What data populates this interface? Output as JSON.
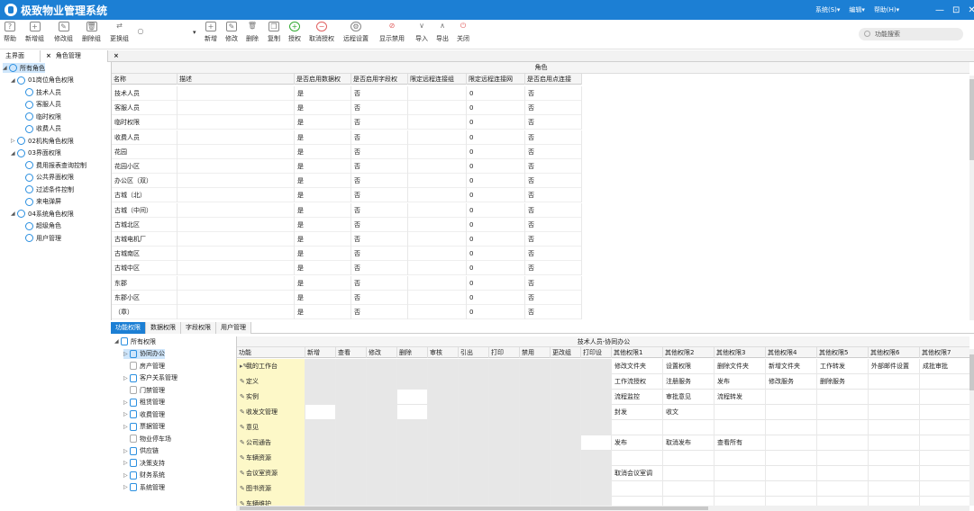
{
  "window": {
    "title": "极致物业管理系统",
    "menus": [
      "系统(S)▾",
      "编辑▾",
      "帮助(H)▾"
    ],
    "controls": [
      "—",
      "⊡",
      "✕"
    ]
  },
  "toolbar": {
    "left": [
      {
        "label": "帮助",
        "icon": "help-icon",
        "glyph": "?"
      },
      {
        "label": "新增组",
        "icon": "add-group-icon",
        "glyph": "+"
      },
      {
        "label": "修改组",
        "icon": "edit-group-icon",
        "glyph": "✎"
      },
      {
        "label": "删除组",
        "icon": "delete-group-icon",
        "glyph": "🗑"
      },
      {
        "label": "更换组",
        "icon": "swap-group-icon",
        "glyph": "⇄"
      },
      {
        "label": "",
        "icon": "search-icon",
        "glyph": "○"
      }
    ],
    "right": [
      {
        "label": "新增",
        "icon": "new-icon",
        "glyph": "+"
      },
      {
        "label": "修改",
        "icon": "edit-icon",
        "glyph": "✎"
      },
      {
        "label": "删除",
        "icon": "delete-icon",
        "glyph": "🗑"
      },
      {
        "label": "复制",
        "icon": "copy-icon",
        "glyph": "❐"
      },
      {
        "label": "授权",
        "icon": "authorize-icon",
        "glyph": "+"
      },
      {
        "label": "取消授权",
        "icon": "unauthorize-icon",
        "glyph": "−"
      },
      {
        "label": "远程设置",
        "icon": "remote-settings-icon",
        "glyph": "⚙"
      },
      {
        "label": "显示禁用",
        "icon": "show-disabled-icon",
        "glyph": "⊘"
      },
      {
        "label": "导入",
        "icon": "import-icon",
        "glyph": "∨"
      },
      {
        "label": "导出",
        "icon": "export-icon",
        "glyph": "∧"
      },
      {
        "label": "关闭",
        "icon": "close-icon",
        "glyph": "⏻"
      }
    ],
    "search_placeholder": "功能搜索"
  },
  "tabs": [
    {
      "label": "主界面"
    },
    {
      "label": "角色管理"
    }
  ],
  "role_tree": [
    {
      "label": "所有角色",
      "level": 0,
      "arrow": "◢",
      "type": "group",
      "selected": true
    },
    {
      "label": "01岗位角色权限",
      "level": 1,
      "arrow": "◢",
      "type": "group"
    },
    {
      "label": "技术人员",
      "level": 2,
      "arrow": "",
      "type": "role"
    },
    {
      "label": "客服人员",
      "level": 2,
      "arrow": "",
      "type": "role"
    },
    {
      "label": "临时权限",
      "level": 2,
      "arrow": "",
      "type": "role"
    },
    {
      "label": "收费人员",
      "level": 2,
      "arrow": "",
      "type": "role"
    },
    {
      "label": "02机构角色权限",
      "level": 1,
      "arrow": "▷",
      "type": "group"
    },
    {
      "label": "03界面权限",
      "level": 1,
      "arrow": "◢",
      "type": "group"
    },
    {
      "label": "费用报表查询控制",
      "level": 2,
      "arrow": "",
      "type": "role"
    },
    {
      "label": "公共界面权限",
      "level": 2,
      "arrow": "",
      "type": "role"
    },
    {
      "label": "过滤条件控制",
      "level": 2,
      "arrow": "",
      "type": "role"
    },
    {
      "label": "来电弹屏",
      "level": 2,
      "arrow": "",
      "type": "role"
    },
    {
      "label": "04系统角色权限",
      "level": 1,
      "arrow": "◢",
      "type": "group"
    },
    {
      "label": "超级角色",
      "level": 2,
      "arrow": "",
      "type": "role"
    },
    {
      "label": "用户管理",
      "level": 2,
      "arrow": "",
      "type": "role"
    }
  ],
  "role_grid": {
    "caption": "角色",
    "columns": [
      "名称",
      "描述",
      "是否启用数据权",
      "是否启用字段权",
      "限定远程连接组",
      "限定远程连接网",
      "是否启用点连接"
    ],
    "rows": [
      [
        "技术人员",
        "",
        "是",
        "否",
        "",
        "0",
        "否"
      ],
      [
        "客服人员",
        "",
        "是",
        "否",
        "",
        "0",
        "否"
      ],
      [
        "临时权限",
        "",
        "是",
        "否",
        "",
        "0",
        "否"
      ],
      [
        "收费人员",
        "",
        "是",
        "否",
        "",
        "0",
        "否"
      ],
      [
        "花园",
        "",
        "是",
        "否",
        "",
        "0",
        "否"
      ],
      [
        "花园小区",
        "",
        "是",
        "否",
        "",
        "0",
        "否"
      ],
      [
        "办公区（双）",
        "",
        "是",
        "否",
        "",
        "0",
        "否"
      ],
      [
        "古城（北）",
        "",
        "是",
        "否",
        "",
        "0",
        "否"
      ],
      [
        "古城（中间）",
        "",
        "是",
        "否",
        "",
        "0",
        "否"
      ],
      [
        "古城北区",
        "",
        "是",
        "否",
        "",
        "0",
        "否"
      ],
      [
        "古城电机厂",
        "",
        "是",
        "否",
        "",
        "0",
        "否"
      ],
      [
        "古城南区",
        "",
        "是",
        "否",
        "",
        "0",
        "否"
      ],
      [
        "古城中区",
        "",
        "是",
        "否",
        "",
        "0",
        "否"
      ],
      [
        "东郡",
        "",
        "是",
        "否",
        "",
        "0",
        "否"
      ],
      [
        "东郡小区",
        "",
        "是",
        "否",
        "",
        "0",
        "否"
      ],
      [
        "（章）",
        "",
        "是",
        "否",
        "",
        "0",
        "否"
      ]
    ]
  },
  "bottom_tabs": [
    "功能权限",
    "数据权限",
    "字段权限",
    "用户管理"
  ],
  "func_tree": [
    {
      "label": "所有权限",
      "level": 0,
      "arrow": "◢"
    },
    {
      "label": "协同办公",
      "level": 1,
      "arrow": "▷",
      "selected": true
    },
    {
      "label": "房产管理",
      "level": 1,
      "arrow": ""
    },
    {
      "label": "客户关系管理",
      "level": 1,
      "arrow": "▷"
    },
    {
      "label": "门禁管理",
      "level": 1,
      "arrow": ""
    },
    {
      "label": "租赁管理",
      "level": 1,
      "arrow": "▷"
    },
    {
      "label": "收费管理",
      "level": 1,
      "arrow": "▷"
    },
    {
      "label": "票据管理",
      "level": 1,
      "arrow": "▷"
    },
    {
      "label": "物业停车场",
      "level": 1,
      "arrow": ""
    },
    {
      "label": "供应链",
      "level": 1,
      "arrow": "▷"
    },
    {
      "label": "决策支持",
      "level": 1,
      "arrow": "▷"
    },
    {
      "label": "财务系统",
      "level": 1,
      "arrow": "▷"
    },
    {
      "label": "系统管理",
      "level": 1,
      "arrow": "▷"
    }
  ],
  "perm_grid": {
    "caption": "技术人员-协同办公",
    "columns": [
      "功能",
      "新增",
      "查看",
      "修改",
      "删除",
      "审核",
      "引出",
      "打印",
      "禁用",
      "更改组",
      "打印设",
      "其他权限1",
      "其他权限2",
      "其他权限3",
      "其他权限4",
      "其他权限5",
      "其他权限6",
      "其他权限7"
    ],
    "rows": [
      {
        "name": "我的工作台",
        "marker": "▸✎",
        "other": [
          "修改文件夹",
          "设置权限",
          "删除文件夹",
          "新增文件夹",
          "工作转发",
          "外部邮件设置",
          "成批审批"
        ]
      },
      {
        "name": "定义",
        "marker": "✎",
        "other": [
          "工作流授权",
          "注册服务",
          "发布",
          "修改服务",
          "删除服务",
          "",
          ""
        ]
      },
      {
        "name": "实例",
        "marker": "✎",
        "other": [
          "流程监控",
          "审批意见",
          "流程转发",
          "",
          "",
          "",
          ""
        ]
      },
      {
        "name": "收发文管理",
        "marker": "✎",
        "other": [
          "封发",
          "收文",
          "",
          "",
          "",
          "",
          ""
        ]
      },
      {
        "name": "意见",
        "marker": "✎",
        "other": [
          "",
          "",
          "",
          "",
          "",
          "",
          ""
        ]
      },
      {
        "name": "公司通告",
        "marker": "✎",
        "other": [
          "发布",
          "取消发布",
          "查看所有",
          "",
          "",
          "",
          ""
        ]
      },
      {
        "name": "车辆资源",
        "marker": "✎",
        "other": [
          "",
          "",
          "",
          "",
          "",
          "",
          ""
        ]
      },
      {
        "name": "会议室资源",
        "marker": "✎",
        "other": [
          "取消会议室调",
          "",
          "",
          "",
          "",
          "",
          ""
        ]
      },
      {
        "name": "图书资源",
        "marker": "✎",
        "other": [
          "",
          "",
          "",
          "",
          "",
          "",
          ""
        ]
      },
      {
        "name": "车辆维护",
        "marker": "✎",
        "other": [
          "",
          "",
          "",
          "",
          "",
          "",
          ""
        ]
      }
    ]
  },
  "colors": {
    "title_bar": "#1c7fd4",
    "selected_row": "#cfe6fb",
    "function_cell": "#fdf8c8",
    "disabled_cell": "#e7e7e7"
  }
}
